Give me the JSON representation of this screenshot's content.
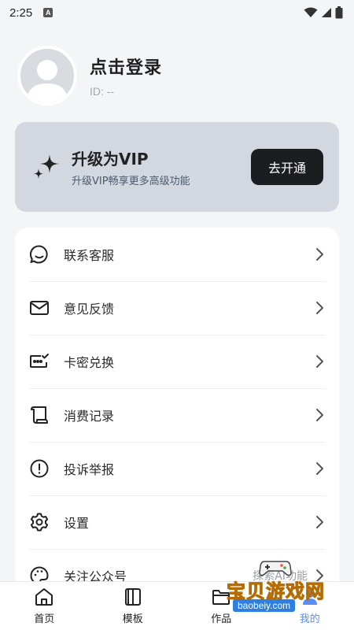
{
  "status_bar": {
    "time": "2:25",
    "a_badge": "A"
  },
  "profile": {
    "login_title": "点击登录",
    "user_id": "ID: --"
  },
  "vip": {
    "title": "升级为VIP",
    "subtitle": "升级VIP畅享更多高级功能",
    "button_label": "去开通",
    "icon": "sparkle-icon"
  },
  "menu": {
    "items": [
      {
        "label": "联系客服",
        "icon": "chat-bubble-icon"
      },
      {
        "label": "意见反馈",
        "icon": "mail-icon"
      },
      {
        "label": "卡密兑换",
        "icon": "ticket-check-icon"
      },
      {
        "label": "消费记录",
        "icon": "receipt-scroll-icon"
      },
      {
        "label": "投诉举报",
        "icon": "alert-circle-icon"
      },
      {
        "label": "设置",
        "icon": "gear-icon"
      },
      {
        "label": "关注公众号",
        "icon": "palette-icon",
        "extra": "探索AI功能"
      }
    ]
  },
  "bottom_nav": {
    "items": [
      {
        "label": "首页",
        "icon": "home-icon"
      },
      {
        "label": "模板",
        "icon": "template-icon"
      },
      {
        "label": "作品",
        "icon": "folder-icon"
      },
      {
        "label": "我的",
        "icon": "profile-icon",
        "active": true
      }
    ]
  },
  "watermark": {
    "text": "宝贝游戏网",
    "url": "baobeiy.com"
  },
  "colors": {
    "background": "#f4f5f7",
    "vip_card": "#d3d7e0",
    "vip_button": "#1c1d20",
    "active_tab": "#5b8cf1"
  }
}
